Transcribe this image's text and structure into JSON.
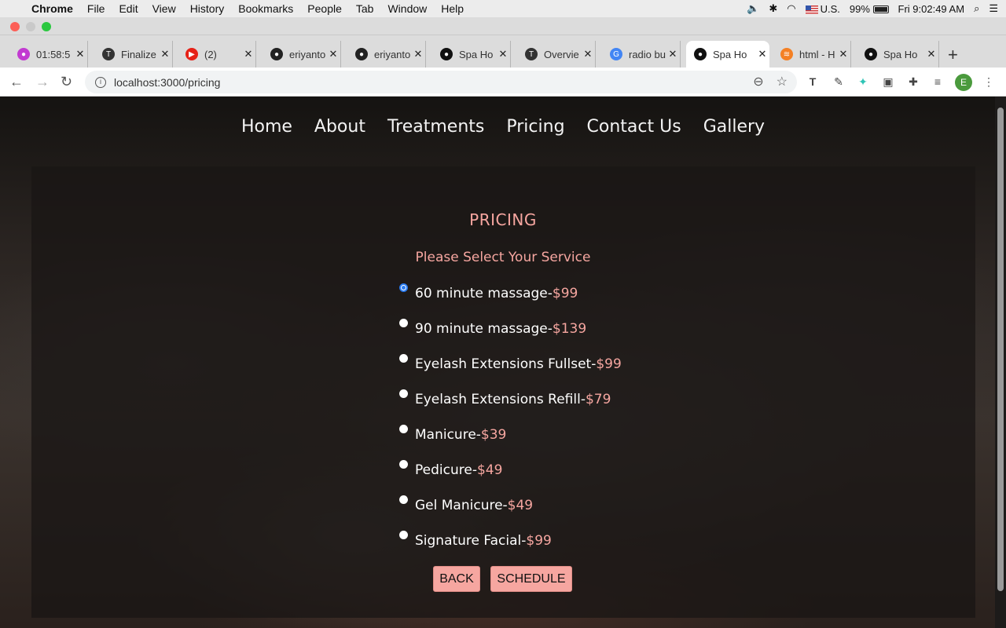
{
  "menubar": {
    "items": [
      "Chrome",
      "File",
      "Edit",
      "View",
      "History",
      "Bookmarks",
      "People",
      "Tab",
      "Window",
      "Help"
    ],
    "locale": "U.S.",
    "battery": "99%",
    "clock": "Fri 9:02:49 AM"
  },
  "tabs": [
    {
      "label": "01:58:5",
      "color": "#c23ad1",
      "glyph": "●"
    },
    {
      "label": "Finalize",
      "color": "#333",
      "glyph": "T"
    },
    {
      "label": "(2)",
      "color": "#e62117",
      "glyph": "▶"
    },
    {
      "label": "eriyanto",
      "color": "#222",
      "glyph": "●"
    },
    {
      "label": "eriyanto",
      "color": "#222",
      "glyph": "●"
    },
    {
      "label": "Spa Ho",
      "color": "#111",
      "glyph": "●"
    },
    {
      "label": "Overvie",
      "color": "#333",
      "glyph": "T"
    },
    {
      "label": "radio bu",
      "color": "#4285f4",
      "glyph": "G"
    },
    {
      "label": "Spa Ho",
      "color": "#111",
      "glyph": "●"
    },
    {
      "label": "html - H",
      "color": "#f48024",
      "glyph": "≋"
    },
    {
      "label": "Spa Ho",
      "color": "#111",
      "glyph": "●"
    }
  ],
  "address": "localhost:3000/pricing",
  "profile_initial": "E",
  "nav": [
    "Home",
    "About",
    "Treatments",
    "Pricing",
    "Contact Us",
    "Gallery"
  ],
  "page": {
    "title": "PRICING",
    "subtitle": "Please Select Your Service",
    "options": [
      {
        "name": "60 minute massage-",
        "price": "$99",
        "selected": true
      },
      {
        "name": "90 minute massage-",
        "price": "$139",
        "selected": false
      },
      {
        "name": "Eyelash Extensions Fullset-",
        "price": "$99",
        "selected": false
      },
      {
        "name": "Eyelash Extensions Refill-",
        "price": "$79",
        "selected": false
      },
      {
        "name": "Manicure-",
        "price": "$39",
        "selected": false
      },
      {
        "name": "Pedicure-",
        "price": "$49",
        "selected": false
      },
      {
        "name": "Gel Manicure-",
        "price": "$49",
        "selected": false
      },
      {
        "name": "Signature Facial-",
        "price": "$99",
        "selected": false
      }
    ],
    "back_label": "BACK",
    "schedule_label": "SCHEDULE"
  },
  "colors": {
    "accent": "#f6a6a0",
    "radio_selected": "#2a7bf0"
  }
}
